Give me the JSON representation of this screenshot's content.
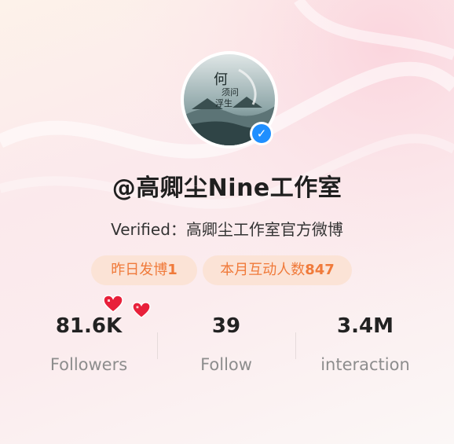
{
  "profile": {
    "handle": "@高卿尘Nine工作室",
    "verified_label": "Verified",
    "verified_sep": "：",
    "verified_desc": "高卿尘工作室官方微博",
    "avatar_badge_icon": "check-icon"
  },
  "chips": [
    {
      "label": "昨日发博",
      "value": "1"
    },
    {
      "label": "本月互动人数",
      "value": "847"
    }
  ],
  "stats": [
    {
      "value": "81.6K",
      "label": "Followers"
    },
    {
      "value": "39",
      "label": "Follow"
    },
    {
      "value": "3.4M",
      "label": "interaction"
    }
  ],
  "colors": {
    "accent": "#f07a3a",
    "chip_bg": "#fbe3d6",
    "verified_blue": "#1f8fff",
    "heart_red": "#e8203a"
  }
}
